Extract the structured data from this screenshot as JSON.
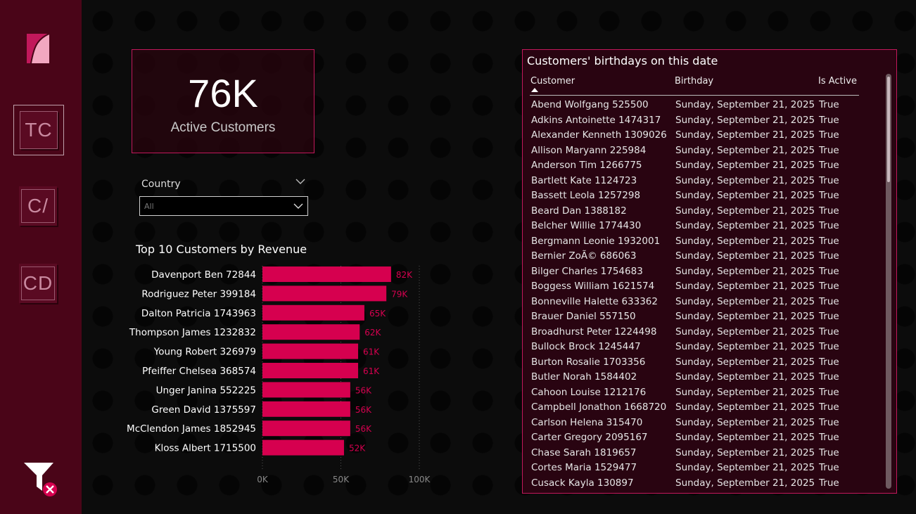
{
  "sidebar": {
    "nav": [
      {
        "label": "TC",
        "active": true
      },
      {
        "label": "C/",
        "active": false
      },
      {
        "label": "CD",
        "active": false
      }
    ]
  },
  "kpi": {
    "value": "76K",
    "label": "Active Customers"
  },
  "slicer": {
    "label": "Country",
    "value": "All"
  },
  "chart_data": {
    "type": "bar",
    "title": "Top 10 Customers by Revenue",
    "categories": [
      "Davenport Ben 72844",
      "Rodriguez Peter 399184",
      "Dalton Patricia 1743963",
      "Thompson James 1232832",
      "Young Robert 326979",
      "Pfeiffer Chelsea 368574",
      "Unger Janina 552225",
      "Green David 1375597",
      "McClendon James 1852945",
      "Kloss Albert 1715500"
    ],
    "values": [
      82000,
      79000,
      65000,
      62000,
      61000,
      61000,
      56000,
      56000,
      56000,
      52000
    ],
    "data_labels": [
      "82K",
      "79K",
      "65K",
      "62K",
      "61K",
      "61K",
      "56K",
      "56K",
      "56K",
      "52K"
    ],
    "xticks": [
      "0K",
      "50K",
      "100K"
    ],
    "xlim": [
      0,
      100000
    ],
    "bar_color": "#d6004f",
    "orientation": "horizontal"
  },
  "table": {
    "title": "Customers' birthdays on this date",
    "columns": [
      "Customer",
      "Birthday",
      "Is Active"
    ],
    "rows": [
      [
        "Abend Wolfgang 525500",
        "Sunday, September 21, 2025",
        "True"
      ],
      [
        "Adkins Antoinette 1474317",
        "Sunday, September 21, 2025",
        "True"
      ],
      [
        "Alexander Kenneth 1309026",
        "Sunday, September 21, 2025",
        "True"
      ],
      [
        "Allison Maryann 225984",
        "Sunday, September 21, 2025",
        "True"
      ],
      [
        "Anderson Tim 1266775",
        "Sunday, September 21, 2025",
        "True"
      ],
      [
        "Bartlett Kate 1124723",
        "Sunday, September 21, 2025",
        "True"
      ],
      [
        "Bassett Leola 1257298",
        "Sunday, September 21, 2025",
        "True"
      ],
      [
        "Beard Dan 1388182",
        "Sunday, September 21, 2025",
        "True"
      ],
      [
        "Belcher Willie 1774430",
        "Sunday, September 21, 2025",
        "True"
      ],
      [
        "Bergmann Leonie 1932001",
        "Sunday, September 21, 2025",
        "True"
      ],
      [
        "Bernier ZoÃ© 686063",
        "Sunday, September 21, 2025",
        "True"
      ],
      [
        "Bilger Charles 1754683",
        "Sunday, September 21, 2025",
        "True"
      ],
      [
        "Boggess William 1621574",
        "Sunday, September 21, 2025",
        "True"
      ],
      [
        "Bonneville Halette 633362",
        "Sunday, September 21, 2025",
        "True"
      ],
      [
        "Brauer Daniel 557150",
        "Sunday, September 21, 2025",
        "True"
      ],
      [
        "Broadhurst Peter 1224498",
        "Sunday, September 21, 2025",
        "True"
      ],
      [
        "Bullock Brock 1245447",
        "Sunday, September 21, 2025",
        "True"
      ],
      [
        "Burton Rosalie 1703356",
        "Sunday, September 21, 2025",
        "True"
      ],
      [
        "Butler Norah 1584402",
        "Sunday, September 21, 2025",
        "True"
      ],
      [
        "Cahoon Louise 1212176",
        "Sunday, September 21, 2025",
        "True"
      ],
      [
        "Campbell Jonathon 1668720",
        "Sunday, September 21, 2025",
        "True"
      ],
      [
        "Carlson Helena 315470",
        "Sunday, September 21, 2025",
        "True"
      ],
      [
        "Carter Gregory 2095167",
        "Sunday, September 21, 2025",
        "True"
      ],
      [
        "Chase Sarah 1819657",
        "Sunday, September 21, 2025",
        "True"
      ],
      [
        "Cortes Maria 1529477",
        "Sunday, September 21, 2025",
        "True"
      ],
      [
        "Cusack Kayla 130897",
        "Sunday, September 21, 2025",
        "True"
      ]
    ]
  },
  "icons": {
    "logo": "logo-icon",
    "clear_filters": "clear-filters-icon"
  },
  "colors": {
    "sidebar": "#4a0518",
    "accent": "#c2185b",
    "bar": "#d6004f",
    "data_label": "#d6004f"
  }
}
